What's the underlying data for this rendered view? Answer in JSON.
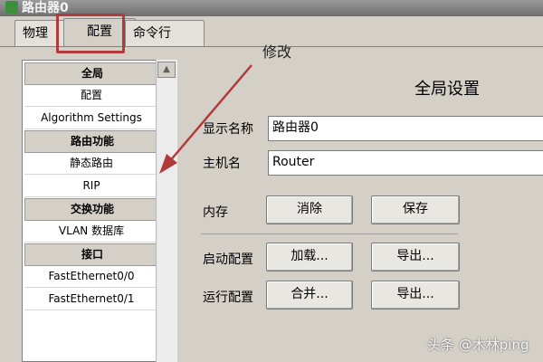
{
  "window": {
    "title": "路由器0"
  },
  "tabs": [
    {
      "label": "物理"
    },
    {
      "label": "配置"
    },
    {
      "label": "命令行"
    }
  ],
  "sidebar": {
    "items": [
      {
        "label": "全局",
        "header": true
      },
      {
        "label": "配置",
        "header": false
      },
      {
        "label": "Algorithm Settings",
        "header": false
      },
      {
        "label": "路由功能",
        "header": true
      },
      {
        "label": "静态路由",
        "header": false
      },
      {
        "label": "RIP",
        "header": false
      },
      {
        "label": "交换功能",
        "header": true
      },
      {
        "label": "VLAN 数据库",
        "header": false
      },
      {
        "label": "接口",
        "header": true
      },
      {
        "label": "FastEthernet0/0",
        "header": false
      },
      {
        "label": "FastEthernet0/1",
        "header": false
      }
    ]
  },
  "annotation": {
    "text": "修改",
    "color": "#b23a3a"
  },
  "main": {
    "title": "全局设置",
    "display_name": {
      "label": "显示名称",
      "value": "路由器0"
    },
    "hostname": {
      "label": "主机名",
      "value": "Router"
    },
    "memory": {
      "label": "内存",
      "erase_button": "消除",
      "save_button": "保存"
    },
    "startup_config": {
      "label": "启动配置",
      "load_button": "加载...",
      "export_button": "导出..."
    },
    "running_config": {
      "label": "运行配置",
      "merge_button": "合并...",
      "export_button": "导出..."
    }
  },
  "watermark": "头条 @木林ping"
}
